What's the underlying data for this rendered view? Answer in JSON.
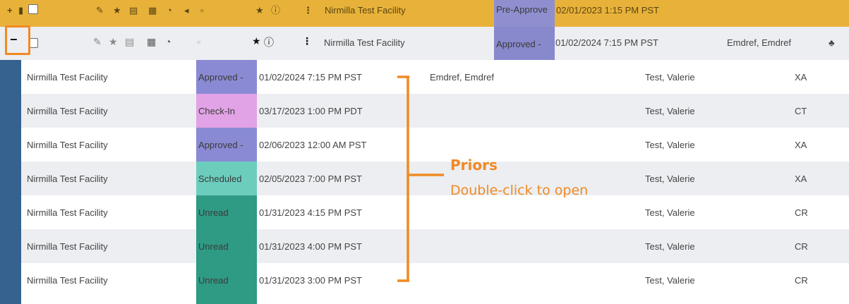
{
  "top_row": {
    "facility": "Nirmilla Test Facility",
    "status": "Pre-Approve",
    "datetime": "02/01/2023 1:15 PM PST",
    "status_color": "#8f8fd0"
  },
  "main_row": {
    "expand_glyph": "−",
    "facility": "Nirmilla Test Facility",
    "status": "Approved - ",
    "datetime": "01/02/2024 7:15 PM PST",
    "referrer": "Emdref, Emdref",
    "status_color": "#8888cc"
  },
  "priors": [
    {
      "facility": "Nirmilla Test Facility",
      "status": "Approved - ",
      "status_color": "#8a8ad4",
      "datetime": "01/02/2024 7:15 PM PST",
      "referrer": "Emdref, Emdref",
      "patient": "Test, Valerie",
      "modality": "XA"
    },
    {
      "facility": "Nirmilla Test Facility",
      "status": "Check-In",
      "status_color": "#e2a3e6",
      "datetime": "03/17/2023 1:00 PM PDT",
      "referrer": "",
      "patient": "Test, Valerie",
      "modality": "CT"
    },
    {
      "facility": "Nirmilla Test Facility",
      "status": "Approved - ",
      "status_color": "#8a8ad4",
      "datetime": "02/06/2023 12:00 AM PST",
      "referrer": "",
      "patient": "Test, Valerie",
      "modality": "XA"
    },
    {
      "facility": "Nirmilla Test Facility",
      "status": "Scheduled",
      "status_color": "#6ccdbd",
      "datetime": "02/05/2023 7:00 PM PST",
      "referrer": "",
      "patient": "Test, Valerie",
      "modality": "XA"
    },
    {
      "facility": "Nirmilla Test Facility",
      "status": "Unread",
      "status_color": "#2f9b84",
      "datetime": "01/31/2023 4:15 PM PST",
      "referrer": "",
      "patient": "Test, Valerie",
      "modality": "CR"
    },
    {
      "facility": "Nirmilla Test Facility",
      "status": "Unread",
      "status_color": "#2f9b84",
      "datetime": "01/31/2023 4:00 PM PST",
      "referrer": "",
      "patient": "Test, Valerie",
      "modality": "CR"
    },
    {
      "facility": "Nirmilla Test Facility",
      "status": "Unread",
      "status_color": "#2f9b84",
      "datetime": "01/31/2023 3:00 PM PST",
      "referrer": "",
      "patient": "Test, Valerie",
      "modality": "CR"
    }
  ],
  "icons": [
    "edit-icon",
    "star-icon",
    "document-icon",
    "grid-icon",
    "clock-icon",
    "share-icon",
    "info-icon",
    "more-vertical-icon",
    "referrer-person-icon"
  ],
  "annotation": {
    "title": "Priors",
    "subtitle": "Double-click to open",
    "color": "#f08a24"
  },
  "colors": {
    "top_row_bg": "#e8b23a",
    "row_alt_bg": "#eceef1",
    "left_bar": "#35628f"
  }
}
